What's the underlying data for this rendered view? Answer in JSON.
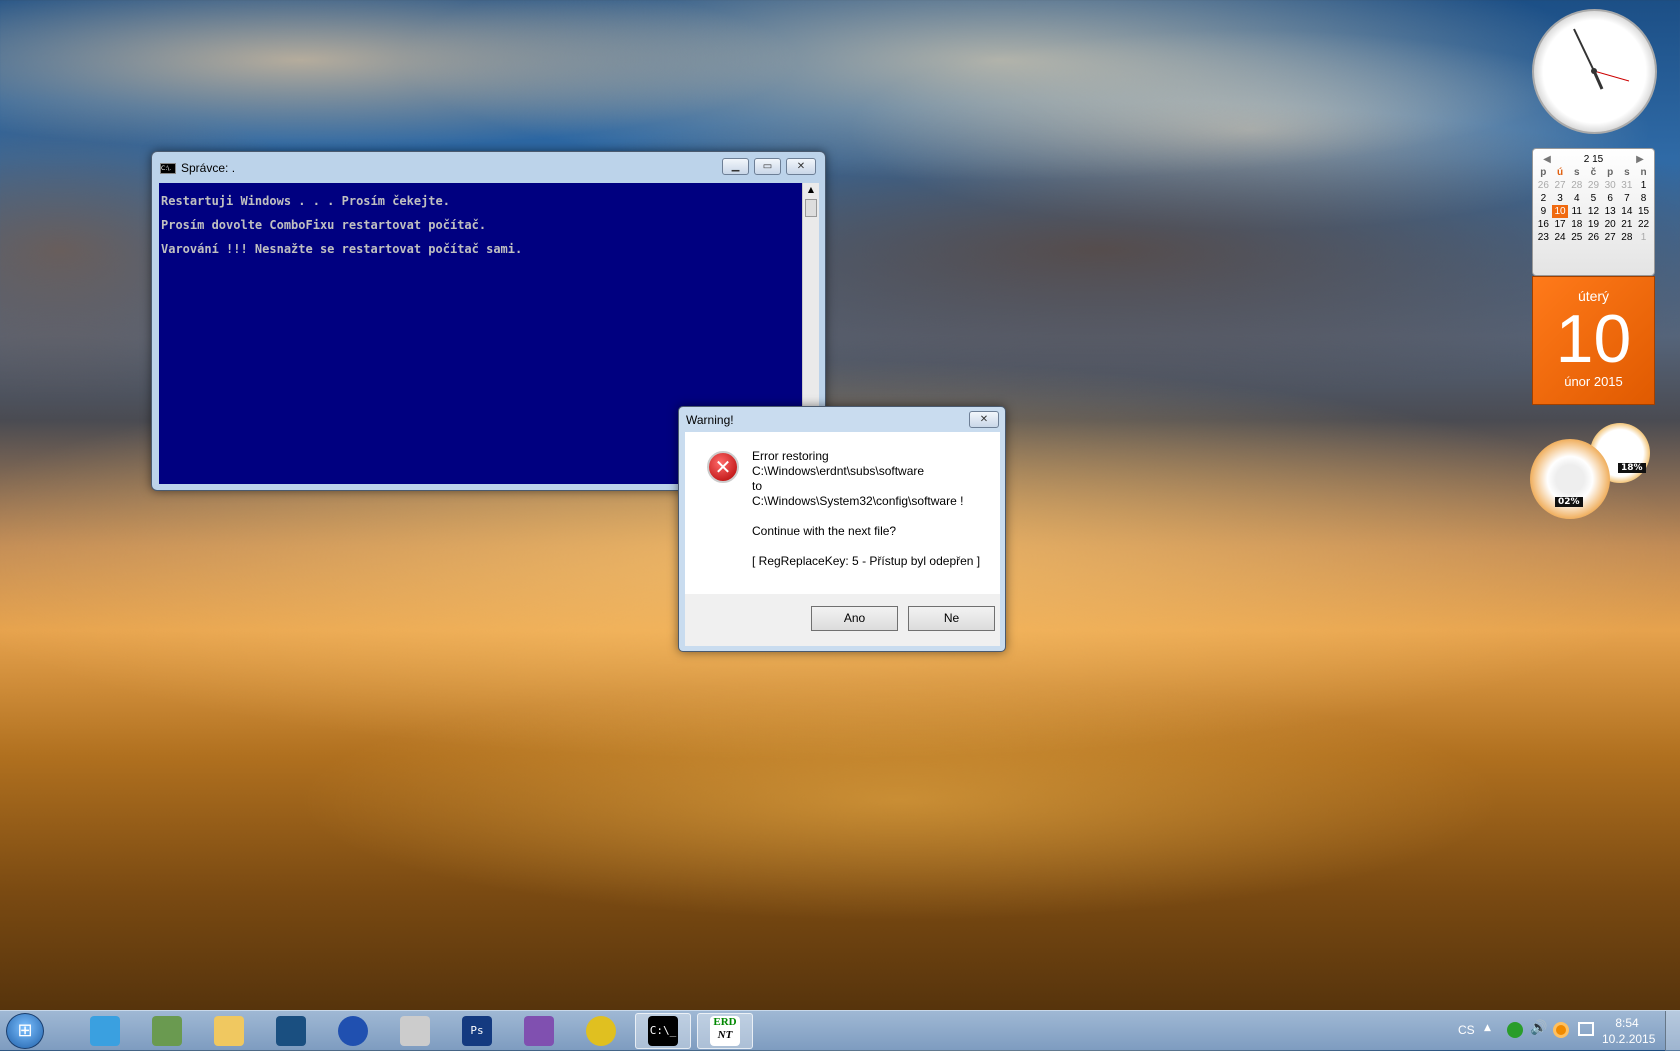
{
  "cmd": {
    "title": "Správce:  .",
    "icon_label": "C:\\.",
    "lines": [
      "Restartuji Windows . . . Prosím čekejte.",
      "Prosím dovolte ComboFixu restartovat počítač.",
      "Varování !!! Nesnažte se restartovat počítač sami."
    ]
  },
  "dialog": {
    "title": "Warning!",
    "lines": [
      "Error restoring",
      "C:\\Windows\\erdnt\\subs\\software",
      "to",
      "C:\\Windows\\System32\\config\\software !",
      "",
      "Continue with the next file?",
      "",
      "[ RegReplaceKey: 5 - Přístup byl odepřen ]"
    ],
    "yes": "Ano",
    "no": "Ne"
  },
  "calendar": {
    "month_nav": "2 15",
    "weekdays": [
      "p",
      "ú",
      "s",
      "č",
      "p",
      "s",
      "n"
    ],
    "weeks": [
      [
        "26",
        "27",
        "28",
        "29",
        "30",
        "31",
        "1"
      ],
      [
        "2",
        "3",
        "4",
        "5",
        "6",
        "7",
        "8"
      ],
      [
        "9",
        "10",
        "11",
        "12",
        "13",
        "14",
        "15"
      ],
      [
        "16",
        "17",
        "18",
        "19",
        "20",
        "21",
        "22"
      ],
      [
        "23",
        "24",
        "25",
        "26",
        "27",
        "28",
        "1"
      ]
    ],
    "today": "10",
    "day_name": "úterý",
    "month_year": "únor 2015"
  },
  "gauges": {
    "cpu": "02%",
    "memory": "18%"
  },
  "taskbar": {
    "apps": [
      "windows-live-icon",
      "photo-gallery-icon",
      "explorer-icon",
      "openoffice-icon",
      "google-earth-icon",
      "photo-tool-icon",
      "photoshop-icon",
      "visual-studio-icon",
      "chrome-icon",
      "cmd-icon",
      "erd-nt-icon"
    ],
    "ps_label": "Ps",
    "cmd_label": "C:\\_",
    "erd_label": "ERD",
    "nt_label": "NT"
  },
  "tray": {
    "language": "CS",
    "time": "8:54",
    "date": "10.2.2015"
  },
  "colors": {
    "console_bg": "#000080",
    "calendar_orange": "#f06a10"
  }
}
